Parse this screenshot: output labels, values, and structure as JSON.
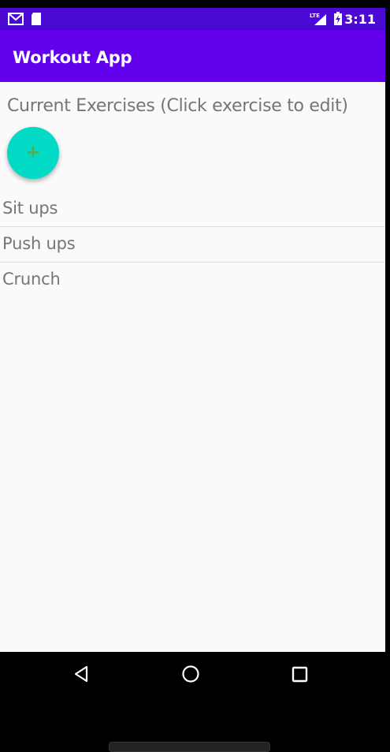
{
  "status_bar": {
    "time": "3:11",
    "icons_left": [
      "gmail-icon",
      "sd-card-icon"
    ],
    "icons_right": [
      "lte-signal-icon",
      "battery-charging-icon"
    ],
    "network_label": "LTE"
  },
  "app_bar": {
    "title": "Workout App",
    "color": "#6200ee"
  },
  "main": {
    "header": "Current Exercises (Click exercise to edit)",
    "fab": {
      "icon": "plus-icon",
      "label": "+",
      "color": "#03dac5"
    },
    "exercises": [
      "Sit ups",
      "Push ups",
      "Crunch"
    ]
  },
  "nav_bar": {
    "buttons": [
      "back-icon",
      "home-icon",
      "recents-icon"
    ]
  }
}
